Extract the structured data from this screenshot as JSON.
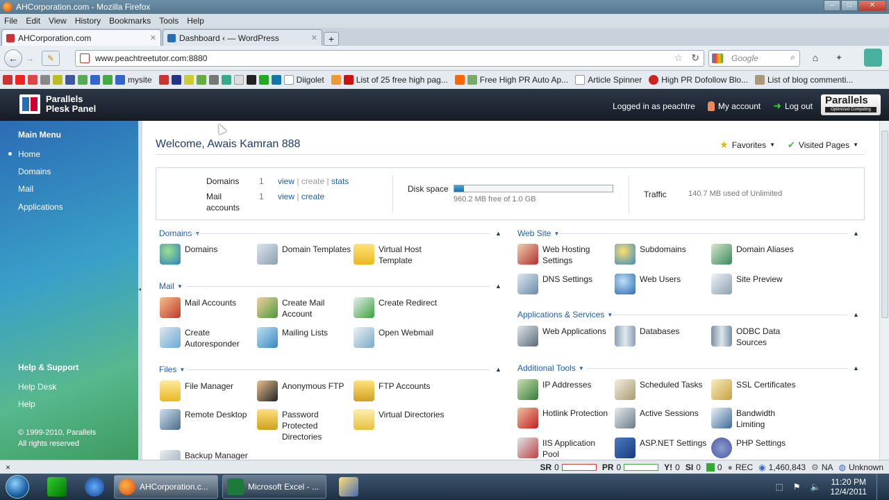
{
  "window": {
    "title": "AHCorporation.com - Mozilla Firefox"
  },
  "menu": [
    "File",
    "Edit",
    "View",
    "History",
    "Bookmarks",
    "Tools",
    "Help"
  ],
  "tabs": [
    {
      "label": "AHCorporation.com",
      "active": true
    },
    {
      "label": "Dashboard ‹ — WordPress",
      "active": false
    }
  ],
  "nav": {
    "url": "www.peachtreetutor.com:8880",
    "search_placeholder": "Google"
  },
  "bookmarks": [
    "mysite",
    "Diigolet",
    "List of 25 free high pag...",
    "Free High PR Auto Ap...",
    "Article Spinner",
    "High PR Dofollow Blo...",
    "List of blog commenti..."
  ],
  "plesk": {
    "logo_line1": "Parallels",
    "logo_line2": "Plesk Panel",
    "logged_in": "Logged in as peachtre",
    "my_account": "My account",
    "log_out": "Log out",
    "brand": "Parallels",
    "brand_sub": "Optimized Computing"
  },
  "sidebar": {
    "main_menu": "Main Menu",
    "items": [
      "Home",
      "Domains",
      "Mail",
      "Applications"
    ],
    "help_title": "Help & Support",
    "help_items": [
      "Help Desk",
      "Help"
    ],
    "copyright1": "© 1999-2010, Parallels",
    "copyright2": "All rights reserved"
  },
  "welcome": "Welcome, Awais Kamran 888",
  "favorites": "Favorites",
  "visited": "Visited Pages",
  "summary": {
    "domains_label": "Domains",
    "domains_count": "1",
    "mail_label1": "Mail",
    "mail_label2": "accounts",
    "mail_count": "1",
    "view": "view",
    "create": "create",
    "stats": "stats",
    "disk_label": "Disk space",
    "disk_text": "960.2 MB free of 1.0 GB",
    "disk_used_fraction": 0.06,
    "traffic_label": "Traffic",
    "traffic_text": "140.7 MB used of Unlimited"
  },
  "sections": {
    "domains": {
      "title": "Domains",
      "tools": [
        [
          "Domains",
          ""
        ],
        [
          "Domain Templates",
          ""
        ],
        [
          "Virtual Host",
          "Template"
        ]
      ]
    },
    "mail": {
      "title": "Mail",
      "tools": [
        [
          "Mail Accounts",
          ""
        ],
        [
          "Create Mail",
          "Account"
        ],
        [
          "Create Redirect",
          ""
        ],
        [
          "Create",
          "Autoresponder"
        ],
        [
          "Mailing Lists",
          ""
        ],
        [
          "Open Webmail",
          ""
        ]
      ]
    },
    "files": {
      "title": "Files",
      "tools": [
        [
          "File Manager",
          ""
        ],
        [
          "Anonymous FTP",
          ""
        ],
        [
          "FTP Accounts",
          ""
        ],
        [
          "Remote Desktop",
          ""
        ],
        [
          "Password",
          "Protected",
          "Directories"
        ],
        [
          "Virtual Directories",
          ""
        ],
        [
          "Backup Manager",
          ""
        ]
      ]
    },
    "website": {
      "title": "Web Site",
      "tools": [
        [
          "Web Hosting",
          "Settings"
        ],
        [
          "Subdomains",
          ""
        ],
        [
          "Domain Aliases",
          ""
        ],
        [
          "DNS Settings",
          ""
        ],
        [
          "Web Users",
          ""
        ],
        [
          "Site Preview",
          ""
        ]
      ]
    },
    "apps": {
      "title": "Applications & Services",
      "tools": [
        [
          "Web Applications",
          ""
        ],
        [
          "Databases",
          ""
        ],
        [
          "ODBC Data",
          "Sources"
        ]
      ]
    },
    "additional": {
      "title": "Additional Tools",
      "tools": [
        [
          "IP Addresses",
          ""
        ],
        [
          "Scheduled Tasks",
          ""
        ],
        [
          "SSL Certificates",
          ""
        ],
        [
          "Hotlink Protection",
          ""
        ],
        [
          "Active Sessions",
          ""
        ],
        [
          "Bandwidth",
          "Limiting"
        ],
        [
          "IIS Application",
          "Pool"
        ],
        [
          "ASP.NET Settings",
          ""
        ],
        [
          "PHP Settings",
          ""
        ]
      ]
    }
  },
  "status": {
    "sr": "SR",
    "sr_val": "0",
    "pr": "PR",
    "pr_val": "0",
    "y": "Y!",
    "y_val": "0",
    "si": "SI",
    "si_val": "0",
    "rec": "REC",
    "rank": "1,460,843",
    "na": "NA",
    "unknown": "Unknown",
    "close": "×"
  },
  "taskbar": {
    "tasks": [
      "AHCorporation.c...",
      "Microsoft Excel - ..."
    ],
    "time": "11:20 PM",
    "date": "12/4/2011"
  }
}
